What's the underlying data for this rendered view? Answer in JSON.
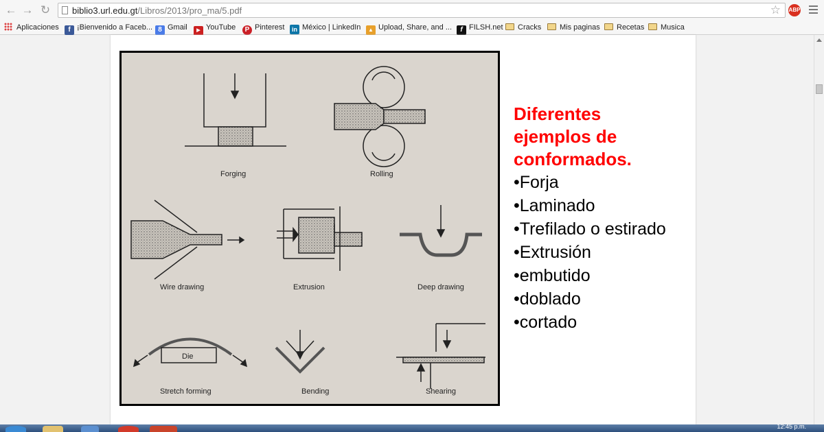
{
  "browser": {
    "url_host": "biblio3.url.edu.gt",
    "url_path": "/Libros/2013/pro_ma/5.pdf",
    "abp_label": "ABP"
  },
  "bookmarks": [
    {
      "label": "Aplicaciones",
      "icon": "apps-grid-icon"
    },
    {
      "label": "¡Bienvenido a Faceb...",
      "icon": "facebook-icon",
      "color": "#3b5998",
      "glyph": "f"
    },
    {
      "label": "Gmail",
      "icon": "google-icon",
      "color": "#4a7be8",
      "glyph": "8"
    },
    {
      "label": "YouTube",
      "icon": "youtube-icon",
      "color": "#cc1f1f",
      "glyph": "▶"
    },
    {
      "label": "Pinterest",
      "icon": "pinterest-icon",
      "color": "#cb2027",
      "glyph": "P"
    },
    {
      "label": "México | LinkedIn",
      "icon": "linkedin-icon",
      "color": "#0e76a8",
      "glyph": "in"
    },
    {
      "label": "Upload, Share, and ...",
      "icon": "upload-icon",
      "color": "#e8a02a",
      "glyph": "▲"
    },
    {
      "label": "FILSH.net",
      "icon": "filsh-icon",
      "color": "#111111",
      "glyph": "f"
    },
    {
      "label": "Cracks",
      "icon": "folder-icon"
    },
    {
      "label": "Mis paginas",
      "icon": "folder-icon"
    },
    {
      "label": "Recetas",
      "icon": "folder-icon"
    },
    {
      "label": "Musica",
      "icon": "folder-icon"
    }
  ],
  "figure": {
    "labels": {
      "forging": "Forging",
      "rolling": "Rolling",
      "wire_drawing": "Wire drawing",
      "extrusion": "Extrusion",
      "deep_drawing": "Deep drawing",
      "die": "Die",
      "stretch_forming": "Stretch forming",
      "bending": "Bending",
      "shearing": "Shearing"
    }
  },
  "slide": {
    "heading_lines": [
      "Diferentes",
      "ejemplos de",
      "conformados."
    ],
    "bullets": [
      "•Forja",
      "•Laminado",
      "•Trefilado o estirado",
      "•Extrusión",
      "•embutido",
      "•doblado",
      "•cortado"
    ]
  },
  "taskbar": {
    "clock": "12:45 p.m."
  },
  "colors": {
    "heading": "#ff0000",
    "figure_bg": "#dad5ce"
  }
}
